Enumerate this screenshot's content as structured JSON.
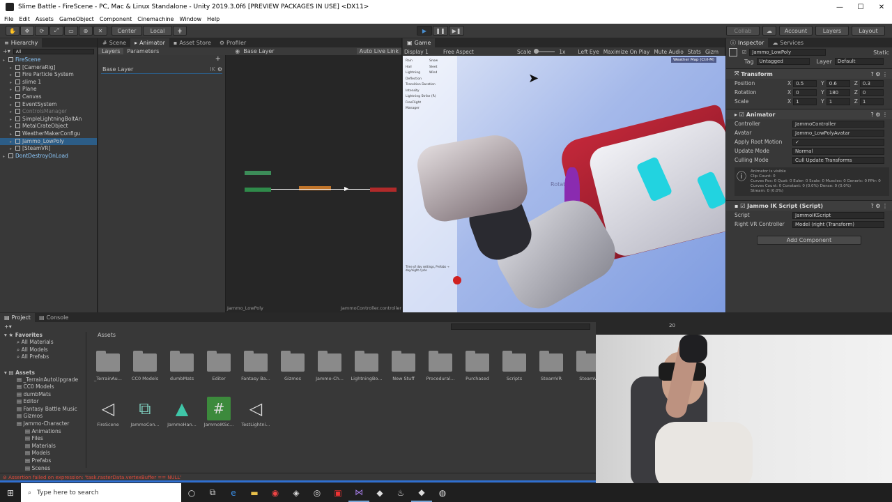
{
  "window": {
    "title": "Slime Battle - FireScene - PC, Mac & Linux Standalone - Unity 2019.3.0f6 [PREVIEW PACKAGES IN USE] <DX11>",
    "minimize": "—",
    "maximize": "☐",
    "close": "✕"
  },
  "menu": [
    "File",
    "Edit",
    "Assets",
    "GameObject",
    "Component",
    "Cinemachine",
    "Window",
    "Help"
  ],
  "toolbar": {
    "center": "Center",
    "local": "Local",
    "collab": "Collab",
    "account": "Account",
    "layers": "Layers",
    "layout": "Layout"
  },
  "hierarchy": {
    "tab": "Hierarchy",
    "search": "All",
    "items": [
      {
        "label": "FireScene",
        "indent": 0,
        "style": "scene"
      },
      {
        "label": "[CameraRig]",
        "indent": 1,
        "style": "normal"
      },
      {
        "label": "Fire Particle System",
        "indent": 1,
        "style": "normal"
      },
      {
        "label": "slime 1",
        "indent": 1,
        "style": "normal"
      },
      {
        "label": "Plane",
        "indent": 1,
        "style": "normal"
      },
      {
        "label": "Canvas",
        "indent": 1,
        "style": "normal"
      },
      {
        "label": "EventSystem",
        "indent": 1,
        "style": "normal"
      },
      {
        "label": "ControlsManager",
        "indent": 1,
        "style": "dim"
      },
      {
        "label": "SimpleLightningBoltAn",
        "indent": 1,
        "style": "normal"
      },
      {
        "label": "MetalCrateObject",
        "indent": 1,
        "style": "normal"
      },
      {
        "label": "WeatherMakerConfigu",
        "indent": 1,
        "style": "normal"
      },
      {
        "label": "Jammo_LowPoly",
        "indent": 1,
        "style": "selected"
      },
      {
        "label": "[SteamVR]",
        "indent": 1,
        "style": "normal"
      },
      {
        "label": "DontDestroyOnLoad",
        "indent": 0,
        "style": "scene"
      }
    ]
  },
  "animator": {
    "tabs": [
      "Scene",
      "Animator",
      "Asset Store",
      "Profiler"
    ],
    "subtabs": [
      "Layers",
      "Parameters"
    ],
    "breadcrumb": "Base Layer",
    "auto_live_link": "Auto Live Link",
    "layer_item": "Base Layer",
    "footer_left": "Jammo_LowPoly",
    "footer_right": "JammoController.controller"
  },
  "game": {
    "tab": "Game",
    "display": "Display 1",
    "aspect": "Free Aspect",
    "scale_label": "Scale",
    "scale_value": "1x",
    "eye": "Left Eye",
    "maximize": "Maximize On Play",
    "mute": "Mute Audio",
    "stats": "Stats",
    "gizmos": "Gizm",
    "overlay_text": "Weather Map (Ctrl-M)",
    "scene_label": "Rotatio",
    "panel_lines": [
      "Rain",
      "Snow",
      "Hail",
      "Sleet",
      "Lightning",
      "Wind",
      "Deflection",
      "Transition Duration",
      "Intensity",
      "Lightning Strike (R)",
      "FreeFlight",
      "Manager"
    ],
    "panel_footer": "Time of day settings, Prefabs → day/night cycle"
  },
  "inspector": {
    "tabs": [
      "Inspector",
      "Services"
    ],
    "object_name": "Jammo_LowPoly",
    "static": "Static",
    "tag_label": "Tag",
    "tag_value": "Untagged",
    "layer_label": "Layer",
    "layer_value": "Default",
    "transform": {
      "title": "Transform",
      "rows": [
        {
          "label": "Position",
          "x": "0.5",
          "y": "0.6",
          "z": "0.3"
        },
        {
          "label": "Rotation",
          "x": "0",
          "y": "180",
          "z": "0"
        },
        {
          "label": "Scale",
          "x": "1",
          "y": "1",
          "z": "1"
        }
      ]
    },
    "animator": {
      "title": "Animator",
      "rows": [
        {
          "label": "Controller",
          "value": "JammoController"
        },
        {
          "label": "Avatar",
          "value": "Jammo_LowPolyAvatar"
        },
        {
          "label": "Apply Root Motion",
          "value": "✓"
        },
        {
          "label": "Update Mode",
          "value": "Normal"
        },
        {
          "label": "Culling Mode",
          "value": "Cull Update Transforms"
        }
      ],
      "info": "Animator is visible\nClip Count: 0\nCurves Pos: 0 Quat: 0 Euler: 0 Scale: 0 Muscles: 0 Generic: 0 PPtr: 0\nCurves Count: 0 Constant: 0 (0.0%) Dense: 0 (0.0%)\nStream: 0 (0.0%)"
    },
    "script": {
      "title": "Jammo IK Script (Script)",
      "rows": [
        {
          "label": "Script",
          "value": "JammoIKScript"
        },
        {
          "label": "Right VR Controller",
          "value": "Model (right (Transform)"
        }
      ]
    },
    "add_component": "Add Component"
  },
  "project": {
    "tabs": [
      "Project",
      "Console"
    ],
    "favorites_title": "Favorites",
    "favorites": [
      "All Materials",
      "All Models",
      "All Prefabs"
    ],
    "assets_title": "Assets",
    "tree": [
      "_TerrainAutoUpgrade",
      "CC0 Models",
      "dumbMats",
      "Editor",
      "Fantasy Battle Music",
      "Gizmos",
      "Jammo-Character",
      "Animations",
      "Files",
      "Materials",
      "Models",
      "Prefabs",
      "Scenes"
    ],
    "breadcrumb": "Assets",
    "count": "20",
    "folders": [
      "_TerrainAu...",
      "CC0 Models",
      "dumbMats",
      "Editor",
      "Fantasy Ba...",
      "Gizmos",
      "Jammo-Ch...",
      "LightningBo...",
      "New Stuff",
      "Procedural...",
      "Purchased",
      "Scripts",
      "SteamVR",
      "SteamV"
    ],
    "files": [
      {
        "label": "FireScene",
        "kind": "unity"
      },
      {
        "label": "JammoCon...",
        "kind": "controller"
      },
      {
        "label": "JammoHan...",
        "kind": "mesh"
      },
      {
        "label": "JammoIKSc...",
        "kind": "script"
      },
      {
        "label": "TestLightni...",
        "kind": "unity"
      }
    ]
  },
  "status": {
    "error": "Assertion failed on expression: 'task.rasterData.vertexBuffer == NULL'"
  },
  "taskbar": {
    "search": "Type here to search"
  },
  "colors": {
    "accent": "#2c5d87",
    "play": "#4a8fd0",
    "error": "#e04a3a",
    "robot_red": "#c4283a",
    "robot_visor": "#22d3e0"
  }
}
